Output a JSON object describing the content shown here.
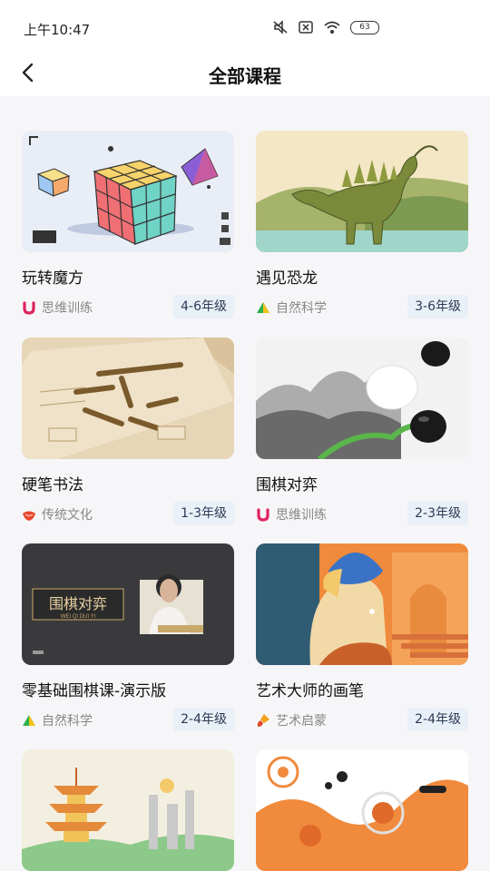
{
  "status": {
    "time": "上午10:47",
    "battery": "63"
  },
  "header": {
    "title": "全部课程"
  },
  "courses": [
    {
      "title": "玩转魔方",
      "category": "思维训练",
      "grade": "4-6年级"
    },
    {
      "title": "遇见恐龙",
      "category": "自然科学",
      "grade": "3-6年级"
    },
    {
      "title": "硬笔书法",
      "category": "传统文化",
      "grade": "1-3年级"
    },
    {
      "title": "围棋对弈",
      "category": "思维训练",
      "grade": "2-3年级"
    },
    {
      "title": "零基础围棋课-演示版",
      "category": "自然科学",
      "grade": "2-4年级"
    },
    {
      "title": "艺术大师的画笔",
      "category": "艺术启蒙",
      "grade": "2-4年级"
    }
  ],
  "thumbs": {
    "go_lesson_sign": "围棋对弈",
    "go_lesson_sub": "WEI QI DUI YI"
  },
  "colors": {
    "思维训练": "#e0245e",
    "自然科学": "#2bb24c",
    "传统文化": "#e8462b",
    "艺术启蒙": "#f2a21b",
    "grade_bg": "#eaf0f7"
  },
  "icons": {
    "思维训练": "u-shape-icon",
    "自然科学": "triangle-icon",
    "传统文化": "lotus-icon",
    "艺术启蒙": "brush-icon"
  }
}
